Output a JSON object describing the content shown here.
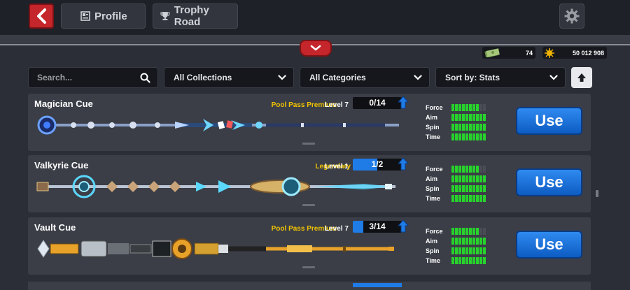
{
  "header": {
    "tabs": [
      {
        "label": "Profile",
        "icon": "profile-icon"
      },
      {
        "label": "Trophy Road",
        "icon": "trophy-icon"
      }
    ],
    "back_icon": "back-arrow-icon",
    "settings_icon": "gear-icon"
  },
  "currency": {
    "cash": "74",
    "coins": "50 012 908"
  },
  "filters": {
    "search_placeholder": "Search...",
    "collections": "All Collections",
    "categories": "All Categories",
    "sort": "Sort by: Stats"
  },
  "stat_labels": {
    "force": "Force",
    "aim": "Aim",
    "spin": "Spin",
    "time": "Time"
  },
  "cues": [
    {
      "name": "Magician Cue",
      "rarity": "Pool Pass Premium",
      "level": "Level 7",
      "progress_text": "0/14",
      "progress_fraction": 0.0,
      "use_label": "Use",
      "stats": {
        "force": 8,
        "aim": 10,
        "spin": 10,
        "time": 10
      }
    },
    {
      "name": "Valkyrie Cue",
      "rarity": "Legendary",
      "level": "Level 1",
      "progress_text": "1/2",
      "progress_fraction": 0.5,
      "use_label": "Use",
      "stats": {
        "force": 8,
        "aim": 10,
        "spin": 10,
        "time": 10
      }
    },
    {
      "name": "Vault Cue",
      "rarity": "Pool Pass Premium",
      "level": "Level 7",
      "progress_text": "3/14",
      "progress_fraction": 0.21,
      "use_label": "Use",
      "stats": {
        "force": 8,
        "aim": 10,
        "spin": 10,
        "time": 10
      }
    }
  ],
  "colors": {
    "accent_red": "#c4262b",
    "use_blue": "#1f7be6",
    "rarity_yellow": "#f2c400",
    "stat_green": "#28d22d"
  }
}
